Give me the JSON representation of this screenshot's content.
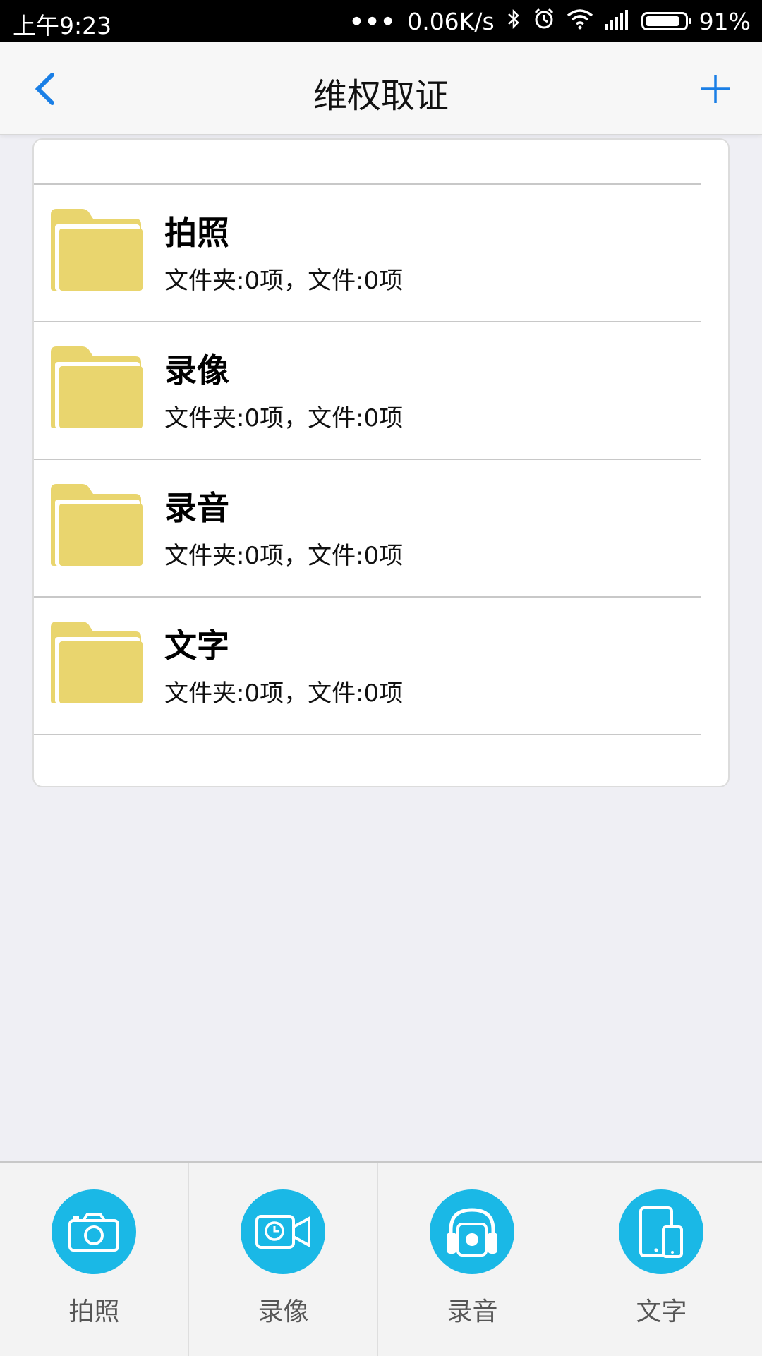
{
  "status_bar": {
    "time": "上午9:23",
    "network_speed": "0.06K/s",
    "battery_percent": "91%",
    "battery_level": 0.91,
    "icons": [
      "more-dots-icon",
      "bluetooth-icon",
      "alarm-icon",
      "wifi-icon",
      "signal-icon",
      "battery-icon"
    ]
  },
  "navbar": {
    "title": "维权取证",
    "accent_color": "#1a7fe6"
  },
  "folders": [
    {
      "name": "拍照",
      "summary": "文件夹:0项，文件:0项"
    },
    {
      "name": "录像",
      "summary": "文件夹:0项，文件:0项"
    },
    {
      "name": "录音",
      "summary": "文件夹:0项，文件:0项"
    },
    {
      "name": "文字",
      "summary": "文件夹:0项，文件:0项"
    }
  ],
  "folder_color": "#e9d56e",
  "tabs": [
    {
      "label": "拍照",
      "icon": "camera-icon"
    },
    {
      "label": "录像",
      "icon": "video-camera-icon"
    },
    {
      "label": "录音",
      "icon": "headphones-icon"
    },
    {
      "label": "文字",
      "icon": "tablet-phone-icon"
    }
  ],
  "tab_icon_color": "#1ab8e6"
}
